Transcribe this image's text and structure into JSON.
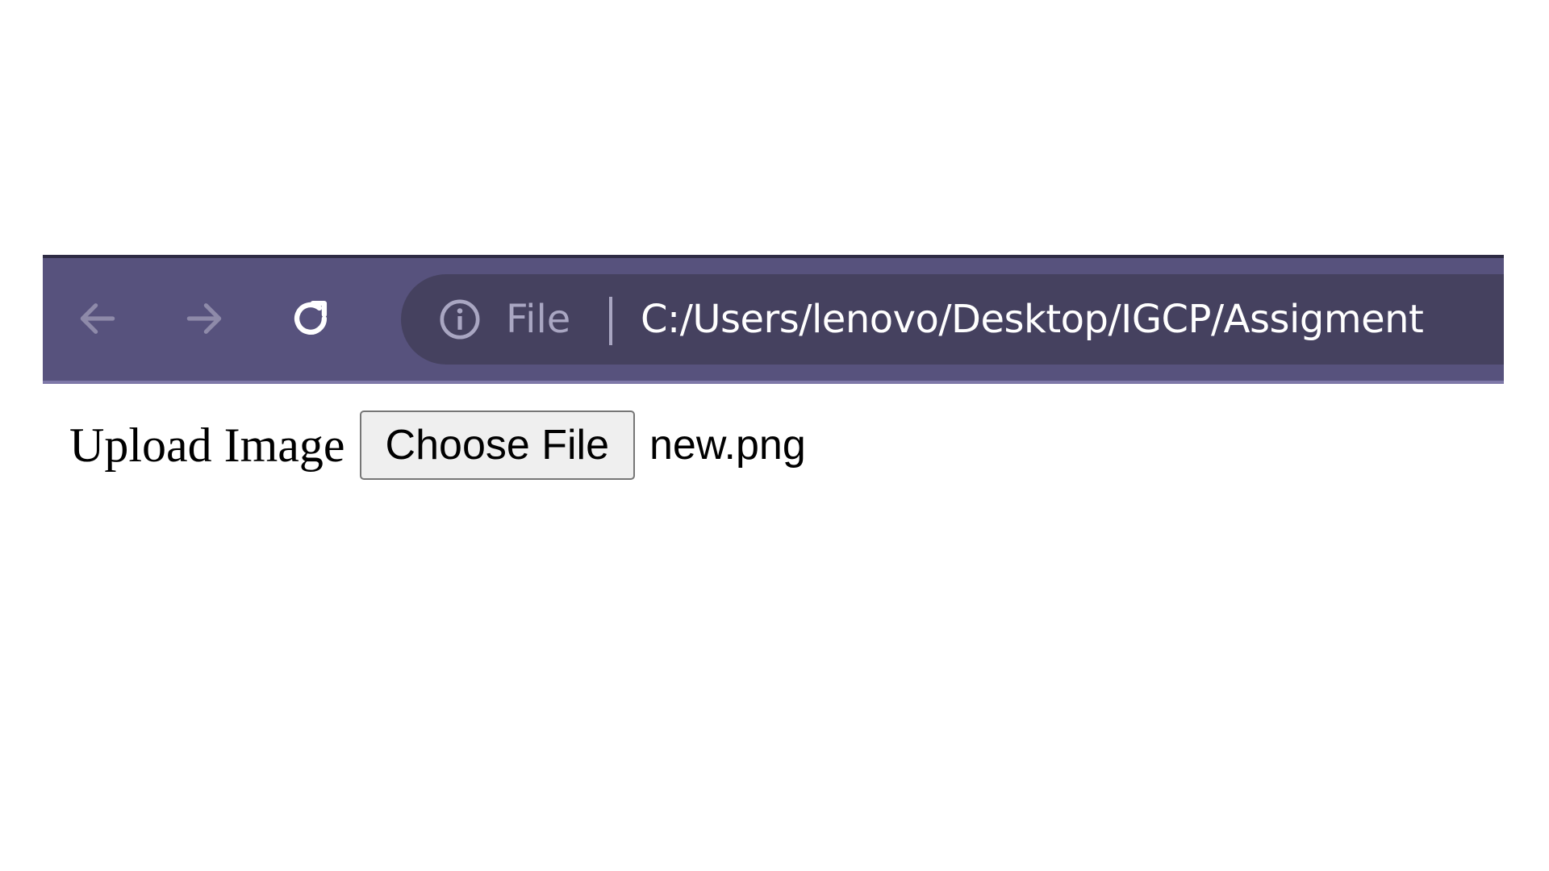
{
  "browser": {
    "address_bar": {
      "scheme_label": "File",
      "url": "C:/Users/lenovo/Desktop/IGCP/Assigment"
    },
    "icons": {
      "back": "arrow-left-icon",
      "forward": "arrow-right-icon",
      "reload": "reload-icon",
      "info": "info-icon"
    },
    "colors": {
      "toolbar": "#57527d",
      "omnibox": "#45415f",
      "url_text": "#ffffff",
      "muted_text": "#a9a6c2"
    }
  },
  "page": {
    "upload_label": "Upload Image",
    "choose_button_label": "Choose File",
    "selected_file": "new.png"
  }
}
